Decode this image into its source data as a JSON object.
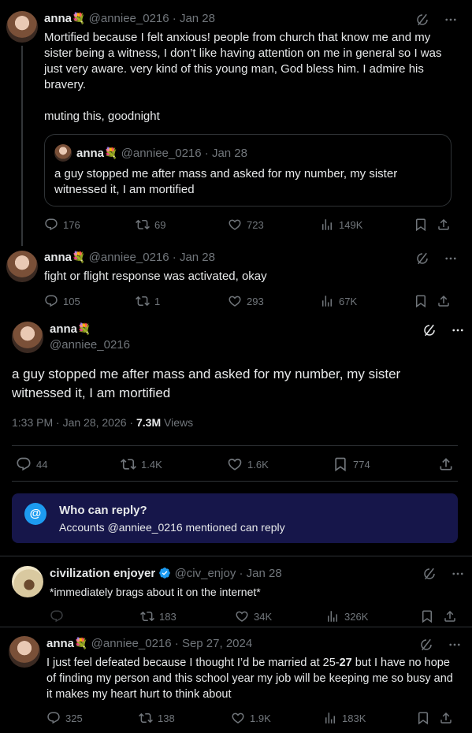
{
  "tweet1": {
    "name": "anna",
    "handle": "@anniee_0216",
    "date": "· Jan 28",
    "text_p1": "Mortified because I felt anxious! people from church that know me and my sister being a witness, I don’t like having attention on me in general so I was just very aware. very kind of this young man, God bless him. I admire his bravery.",
    "text_p2": "muting this, goodnight",
    "quote": {
      "name": "anna",
      "handle": "@anniee_0216",
      "date": "· Jan 28",
      "text": "a guy stopped me after mass and asked for my number, my sister witnessed it, I am mortified"
    },
    "replies": "176",
    "reposts": "69",
    "likes": "723",
    "views": "149K"
  },
  "tweet2": {
    "name": "anna",
    "handle": "@anniee_0216",
    "date": "· Jan 28",
    "text": "fight or flight response was activated, okay",
    "replies": "105",
    "reposts": "1",
    "likes": "293",
    "views": "67K"
  },
  "main": {
    "name": "anna",
    "handle": "@anniee_0216",
    "text": "a guy stopped me after mass and asked for my number, my sister witnessed it, I am mortified",
    "time": "1:33 PM · Jan 28, 2026 · ",
    "views_count": "7.3M",
    "views_label": " Views",
    "replies": "44",
    "reposts": "1.4K",
    "likes": "1.6K",
    "bookmarks": "774"
  },
  "reply_notice": {
    "title": "Who can reply?",
    "body": "Accounts @anniee_0216 mentioned can reply"
  },
  "reply1": {
    "name": "civilization enjoyer",
    "handle": "@civ_enjoy",
    "date": "· Jan 28",
    "text": "*immediately brags about it on the internet*",
    "reposts": "183",
    "likes": "34K",
    "views": "326K"
  },
  "tweet4": {
    "name": "anna",
    "handle": "@anniee_0216",
    "date": "· Sep 27, 2024",
    "text_before": "I just feel defeated because I thought I’d be married at 25-",
    "text_bold": "27",
    "text_after": " but I have no hope of finding my person and this school year my job will be keeping me so busy and it makes my heart hurt to think about",
    "replies": "325",
    "reposts": "138",
    "likes": "1.9K",
    "views": "183K"
  },
  "colors": {
    "background": "#000000",
    "text": "#e7e9ea",
    "muted": "#71767b",
    "accent": "#1d9bf0",
    "notice_bg": "#16164a"
  }
}
